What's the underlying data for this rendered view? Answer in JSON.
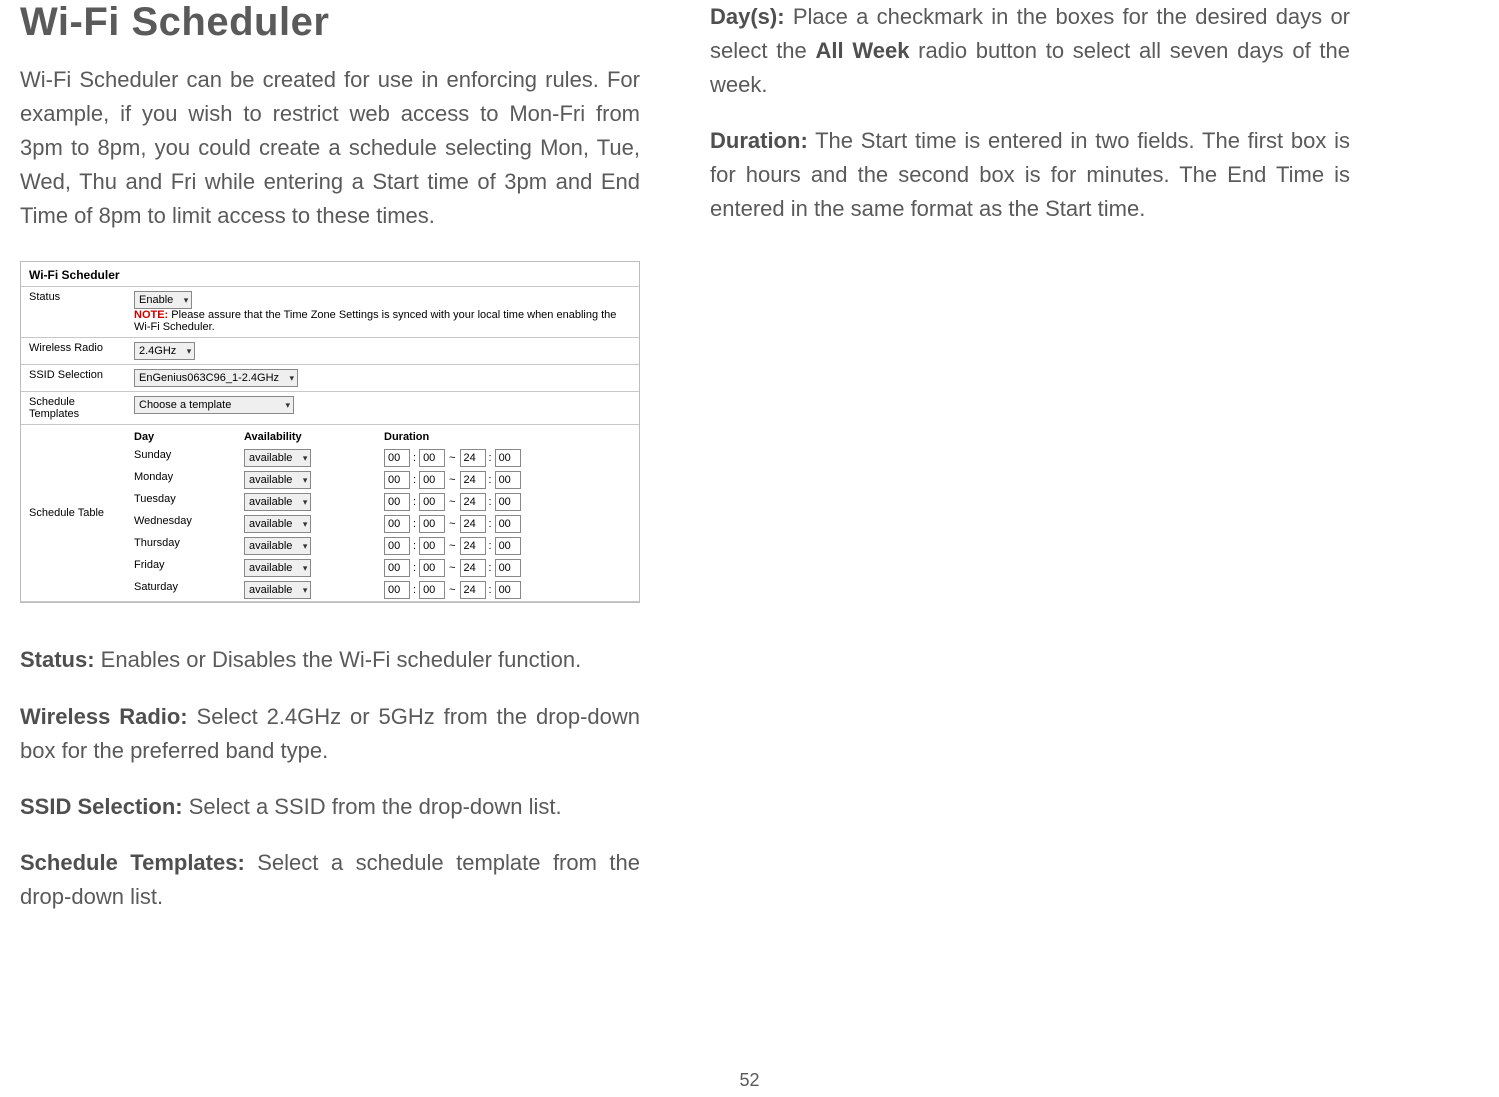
{
  "left": {
    "title": "Wi-Fi Scheduler",
    "intro": "Wi-Fi Scheduler can be created for use in enforcing rules. For example, if you wish to restrict web access to Mon-Fri from 3pm to 8pm, you could create a schedule selecting Mon, Tue, Wed, Thu and Fri while entering a Start time of 3pm and End Time of 8pm to limit access to these times.",
    "status_label": "Status:",
    "status_text": " Enables or Disables the Wi-Fi scheduler function.",
    "wr_label": "Wireless Radio:",
    "wr_text": " Select 2.4GHz or 5GHz from the drop-down box for the preferred band type.",
    "ssid_label": "SSID Selection:",
    "ssid_text": " Select a SSID from the drop-down list.",
    "st_label": "Schedule Templates:",
    "st_text": " Select a schedule template from the drop-down list."
  },
  "right": {
    "days_label": "Day(s):",
    "days_text_a": " Place a checkmark in the boxes for the desired days or select the ",
    "days_bold": "All Week",
    "days_text_b": " radio button to select all seven days of the week.",
    "dur_label": "Duration:",
    "dur_text": " The Start time is entered in two fields. The first box is for hours and the second box is for minutes. The End Time is entered in the same format as the Start time."
  },
  "shot": {
    "title": "Wi-Fi Scheduler",
    "rows": {
      "status": "Status",
      "status_sel": "Enable",
      "note_prefix": "NOTE:",
      "note_text": "  Please assure that the Time Zone Settings is synced with your local time when enabling the Wi-Fi Scheduler.",
      "wr": "Wireless Radio",
      "wr_sel": "2.4GHz",
      "ssid": "SSID Selection",
      "ssid_sel": "EnGenius063C96_1-2.4GHz",
      "tmpl": "Schedule Templates",
      "tmpl_sel": "Choose a template",
      "sched": "Schedule Table",
      "h_day": "Day",
      "h_avail": "Availability",
      "h_dur": "Duration"
    },
    "days": [
      {
        "d": "Sunday",
        "a": "available",
        "sh": "00",
        "sm": "00",
        "eh": "24",
        "em": "00"
      },
      {
        "d": "Monday",
        "a": "available",
        "sh": "00",
        "sm": "00",
        "eh": "24",
        "em": "00"
      },
      {
        "d": "Tuesday",
        "a": "available",
        "sh": "00",
        "sm": "00",
        "eh": "24",
        "em": "00"
      },
      {
        "d": "Wednesday",
        "a": "available",
        "sh": "00",
        "sm": "00",
        "eh": "24",
        "em": "00"
      },
      {
        "d": "Thursday",
        "a": "available",
        "sh": "00",
        "sm": "00",
        "eh": "24",
        "em": "00"
      },
      {
        "d": "Friday",
        "a": "available",
        "sh": "00",
        "sm": "00",
        "eh": "24",
        "em": "00"
      },
      {
        "d": "Saturday",
        "a": "available",
        "sh": "00",
        "sm": "00",
        "eh": "24",
        "em": "00"
      }
    ]
  },
  "page_num": "52"
}
